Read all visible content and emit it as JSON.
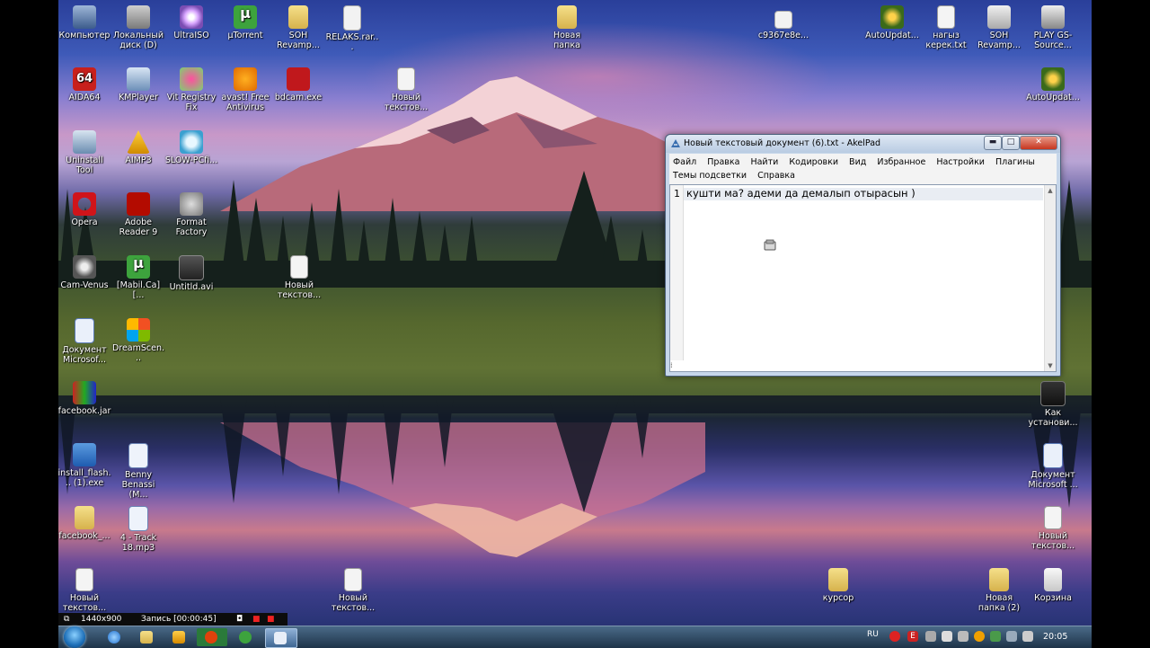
{
  "desktop": {
    "icons": [
      {
        "id": "computer",
        "label": "Компьютер",
        "icon": "computer-icon"
      },
      {
        "id": "local-disk",
        "label": "Локальный диск (D)",
        "icon": "disk-icon"
      },
      {
        "id": "ultraiso",
        "label": "UltraISO",
        "icon": "ultraiso-icon"
      },
      {
        "id": "utorrent",
        "label": "µTorrent",
        "icon": "utorrent-icon"
      },
      {
        "id": "soh-revamp-1",
        "label": "SOH Revamp...",
        "icon": "folder-icon"
      },
      {
        "id": "relaks",
        "label": "RELAKS.rar...",
        "icon": "file-icon"
      },
      {
        "id": "new-folder-1",
        "label": "Новая папка",
        "icon": "folder-icon"
      },
      {
        "id": "c8-file",
        "label": "c9367e8e...",
        "icon": "file-icon"
      },
      {
        "id": "autoupdate-1",
        "label": "AutoUpdat...",
        "icon": "game-icon"
      },
      {
        "id": "nagas",
        "label": "нагыз керек.txt",
        "icon": "txt-icon"
      },
      {
        "id": "soh-revamp-2",
        "label": "SOH Revamp...",
        "icon": "soh-icon"
      },
      {
        "id": "play-gs",
        "label": "PLAY GS-Source...",
        "icon": "play-icon"
      },
      {
        "id": "aida64",
        "label": "AIDA64",
        "icon": "aida64-icon"
      },
      {
        "id": "kmplayer",
        "label": "KMPlayer",
        "icon": "kmplayer-icon"
      },
      {
        "id": "vit-registry",
        "label": "Vit Registry Fix",
        "icon": "vit-icon"
      },
      {
        "id": "avast",
        "label": "avast! Free Antivirus",
        "icon": "avast-icon"
      },
      {
        "id": "bdcam",
        "label": "bdcam.exe",
        "icon": "bdcam-icon"
      },
      {
        "id": "new-text-1",
        "label": "Новый текстов...",
        "icon": "txt-icon"
      },
      {
        "id": "autoupdate-2",
        "label": "AutoUpdat...",
        "icon": "game-icon"
      },
      {
        "id": "uninstall-tool",
        "label": "Uninstall Tool",
        "icon": "uninstall-icon"
      },
      {
        "id": "aimp3",
        "label": "AIMP3",
        "icon": "aimp-icon"
      },
      {
        "id": "slow-pc",
        "label": "SLOW-PCfi...",
        "icon": "slowpc-icon"
      },
      {
        "id": "opera",
        "label": "Opera",
        "icon": "opera-icon"
      },
      {
        "id": "adobe-reader",
        "label": "Adobe Reader 9",
        "icon": "adobe-icon"
      },
      {
        "id": "format-factory",
        "label": "Format Factory",
        "icon": "formatfactory-icon"
      },
      {
        "id": "cam-venus",
        "label": "Cam-Venus",
        "icon": "cam-icon"
      },
      {
        "id": "mabil",
        "label": "[Mabil.Ca][...",
        "icon": "utorrent-icon"
      },
      {
        "id": "untitled-avi",
        "label": "Untitld.avi",
        "icon": "video-icon"
      },
      {
        "id": "new-text-2",
        "label": "Новый текстов...",
        "icon": "txt-icon"
      },
      {
        "id": "doc-ms-1",
        "label": "Документ Microsof...",
        "icon": "doc-icon"
      },
      {
        "id": "dreamscene",
        "label": "DreamScen...",
        "icon": "dreamscene-icon"
      },
      {
        "id": "facebook-jar",
        "label": "facebook.jar",
        "icon": "jar-icon"
      },
      {
        "id": "kak",
        "label": "Как установи...",
        "icon": "video-icon"
      },
      {
        "id": "install-flash",
        "label": "install_flash... (1).exe",
        "icon": "flash-icon"
      },
      {
        "id": "benny",
        "label": "Benny Benassi (M...",
        "icon": "mp3-icon"
      },
      {
        "id": "doc-ms-2",
        "label": "Документ Microsoft ...",
        "icon": "doc-icon"
      },
      {
        "id": "facebook-2",
        "label": "facebook_...",
        "icon": "folder-icon"
      },
      {
        "id": "track-18",
        "label": "4 - Track 18.mp3",
        "icon": "mp3-icon"
      },
      {
        "id": "new-text-3",
        "label": "Новый текстов...",
        "icon": "txt-icon"
      },
      {
        "id": "new-text-4",
        "label": "Новый текстов...",
        "icon": "txt-icon"
      },
      {
        "id": "new-text-5",
        "label": "Новый текстов...",
        "icon": "txt-icon"
      },
      {
        "id": "kursor",
        "label": "курсор",
        "icon": "folder-icon"
      },
      {
        "id": "new-folder-2",
        "label": "Новая папка (2)",
        "icon": "folder-icon"
      },
      {
        "id": "recycle-bin",
        "label": "Корзина",
        "icon": "recycle-bin-icon"
      }
    ]
  },
  "akelpad": {
    "title": "Новый текстовый документ (6).txt - AkelPad",
    "min_label": "▬",
    "max_label": "□",
    "close_label": "✕",
    "menu_row1": [
      "Файл",
      "Правка",
      "Найти",
      "Кодировки",
      "Вид",
      "Избранное",
      "Настройки",
      "Плагины"
    ],
    "menu_row2": [
      "Темы подсветки",
      "Справка"
    ],
    "line_number": "1",
    "text": "кушти ма? адеми да демалып отырасын )"
  },
  "recorder": {
    "resolution": "1440x900",
    "status": "Запись [00:00:45]"
  },
  "taskbar": {
    "language": "RU",
    "time": "20:05"
  },
  "colors": {
    "accent": "#1d6fb8",
    "close_button": "#c6361f",
    "taskbar": "#1e3348"
  }
}
